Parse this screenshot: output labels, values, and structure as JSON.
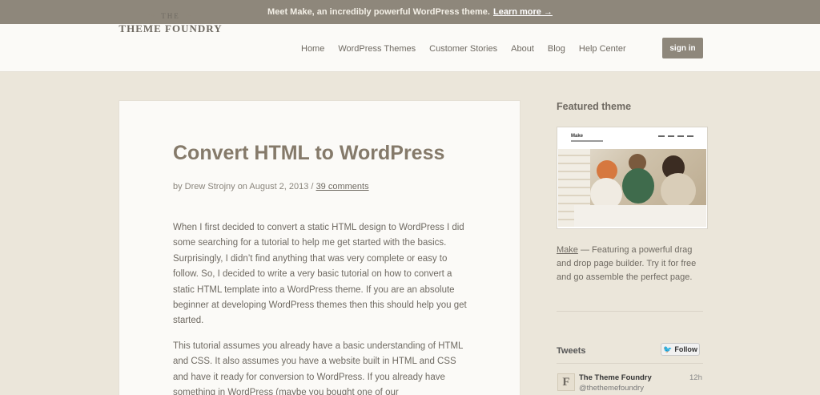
{
  "announcement": {
    "text": "Meet Make, an incredibly powerful WordPress theme.",
    "link": "Learn more →"
  },
  "logo": {
    "the": "THE",
    "name": "THEME FOUNDRY"
  },
  "nav": [
    "Home",
    "WordPress Themes",
    "Customer Stories",
    "About",
    "Blog",
    "Help Center"
  ],
  "signin_label": "sign in",
  "article": {
    "title": "Convert HTML to WordPress",
    "byline_prefix": "by Drew Strojny on August 2, 2013 /",
    "comments": "39 comments",
    "paragraph1": "When I first decided to convert a static HTML design to WordPress I did some searching for a tutorial to help me get started with the basics. Surprisingly, I didn’t find anything that was very complete or easy to follow. So, I decided to write a very basic tutorial on how to convert a static HTML template into a WordPress theme. If you are an absolute beginner at developing WordPress themes then this should help you get started.",
    "paragraph2": "This tutorial assumes you already have a basic understanding of HTML and CSS. It also assumes you have a website built in HTML and CSS and have it ready for conversion to WordPress. If you already have something in WordPress (maybe you bought one of our"
  },
  "sidebar": {
    "featured_heading": "Featured theme",
    "featured_image_brand": "Make",
    "featured_link": "Make",
    "featured_text": " — Featuring a powerful drag and drop page builder. Try it for free and go assemble the perfect page.",
    "tweets_heading": "Tweets",
    "follow_label": "Follow",
    "tweet": {
      "avatar_letter": "F",
      "name": "The Theme Foundry",
      "handle": "@thethemefoundry",
      "time": "12h"
    }
  },
  "colors": {
    "accent": "#8e877b",
    "background": "#ebe6da",
    "title": "#857a6a"
  }
}
